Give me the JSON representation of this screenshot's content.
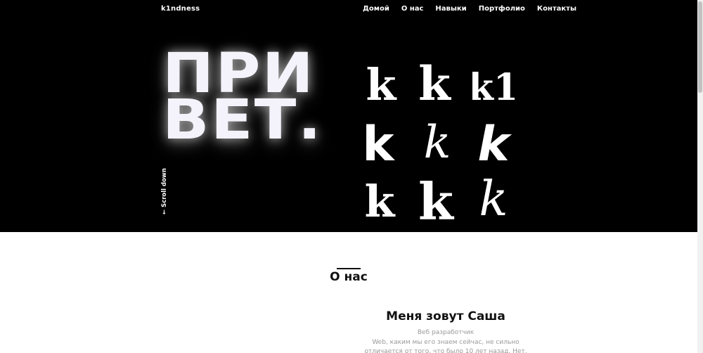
{
  "header": {
    "logo": "k1ndness",
    "nav": [
      "Домой",
      "О нас",
      "Навыки",
      "Портфолио",
      "Контакты"
    ]
  },
  "hero": {
    "line1": "ПРИ",
    "line2": "ВЕТ.",
    "scroll_label": "← Scroll down",
    "letter_grid": [
      "k",
      "k",
      "k1",
      "k",
      "k",
      "k",
      "k",
      "k",
      "k"
    ]
  },
  "about": {
    "title": "О нас",
    "name": "Меня зовут Саша",
    "role": "Веб разработчик",
    "description": "Web, каким мы его знаем сейчас, не сильно отличается от того, что было 10 лет назад. Нет, конечно же он стал более"
  },
  "colors": {
    "hero_bg": "#000000",
    "text_light": "#f4f2fa",
    "muted": "#9a9a9a"
  }
}
